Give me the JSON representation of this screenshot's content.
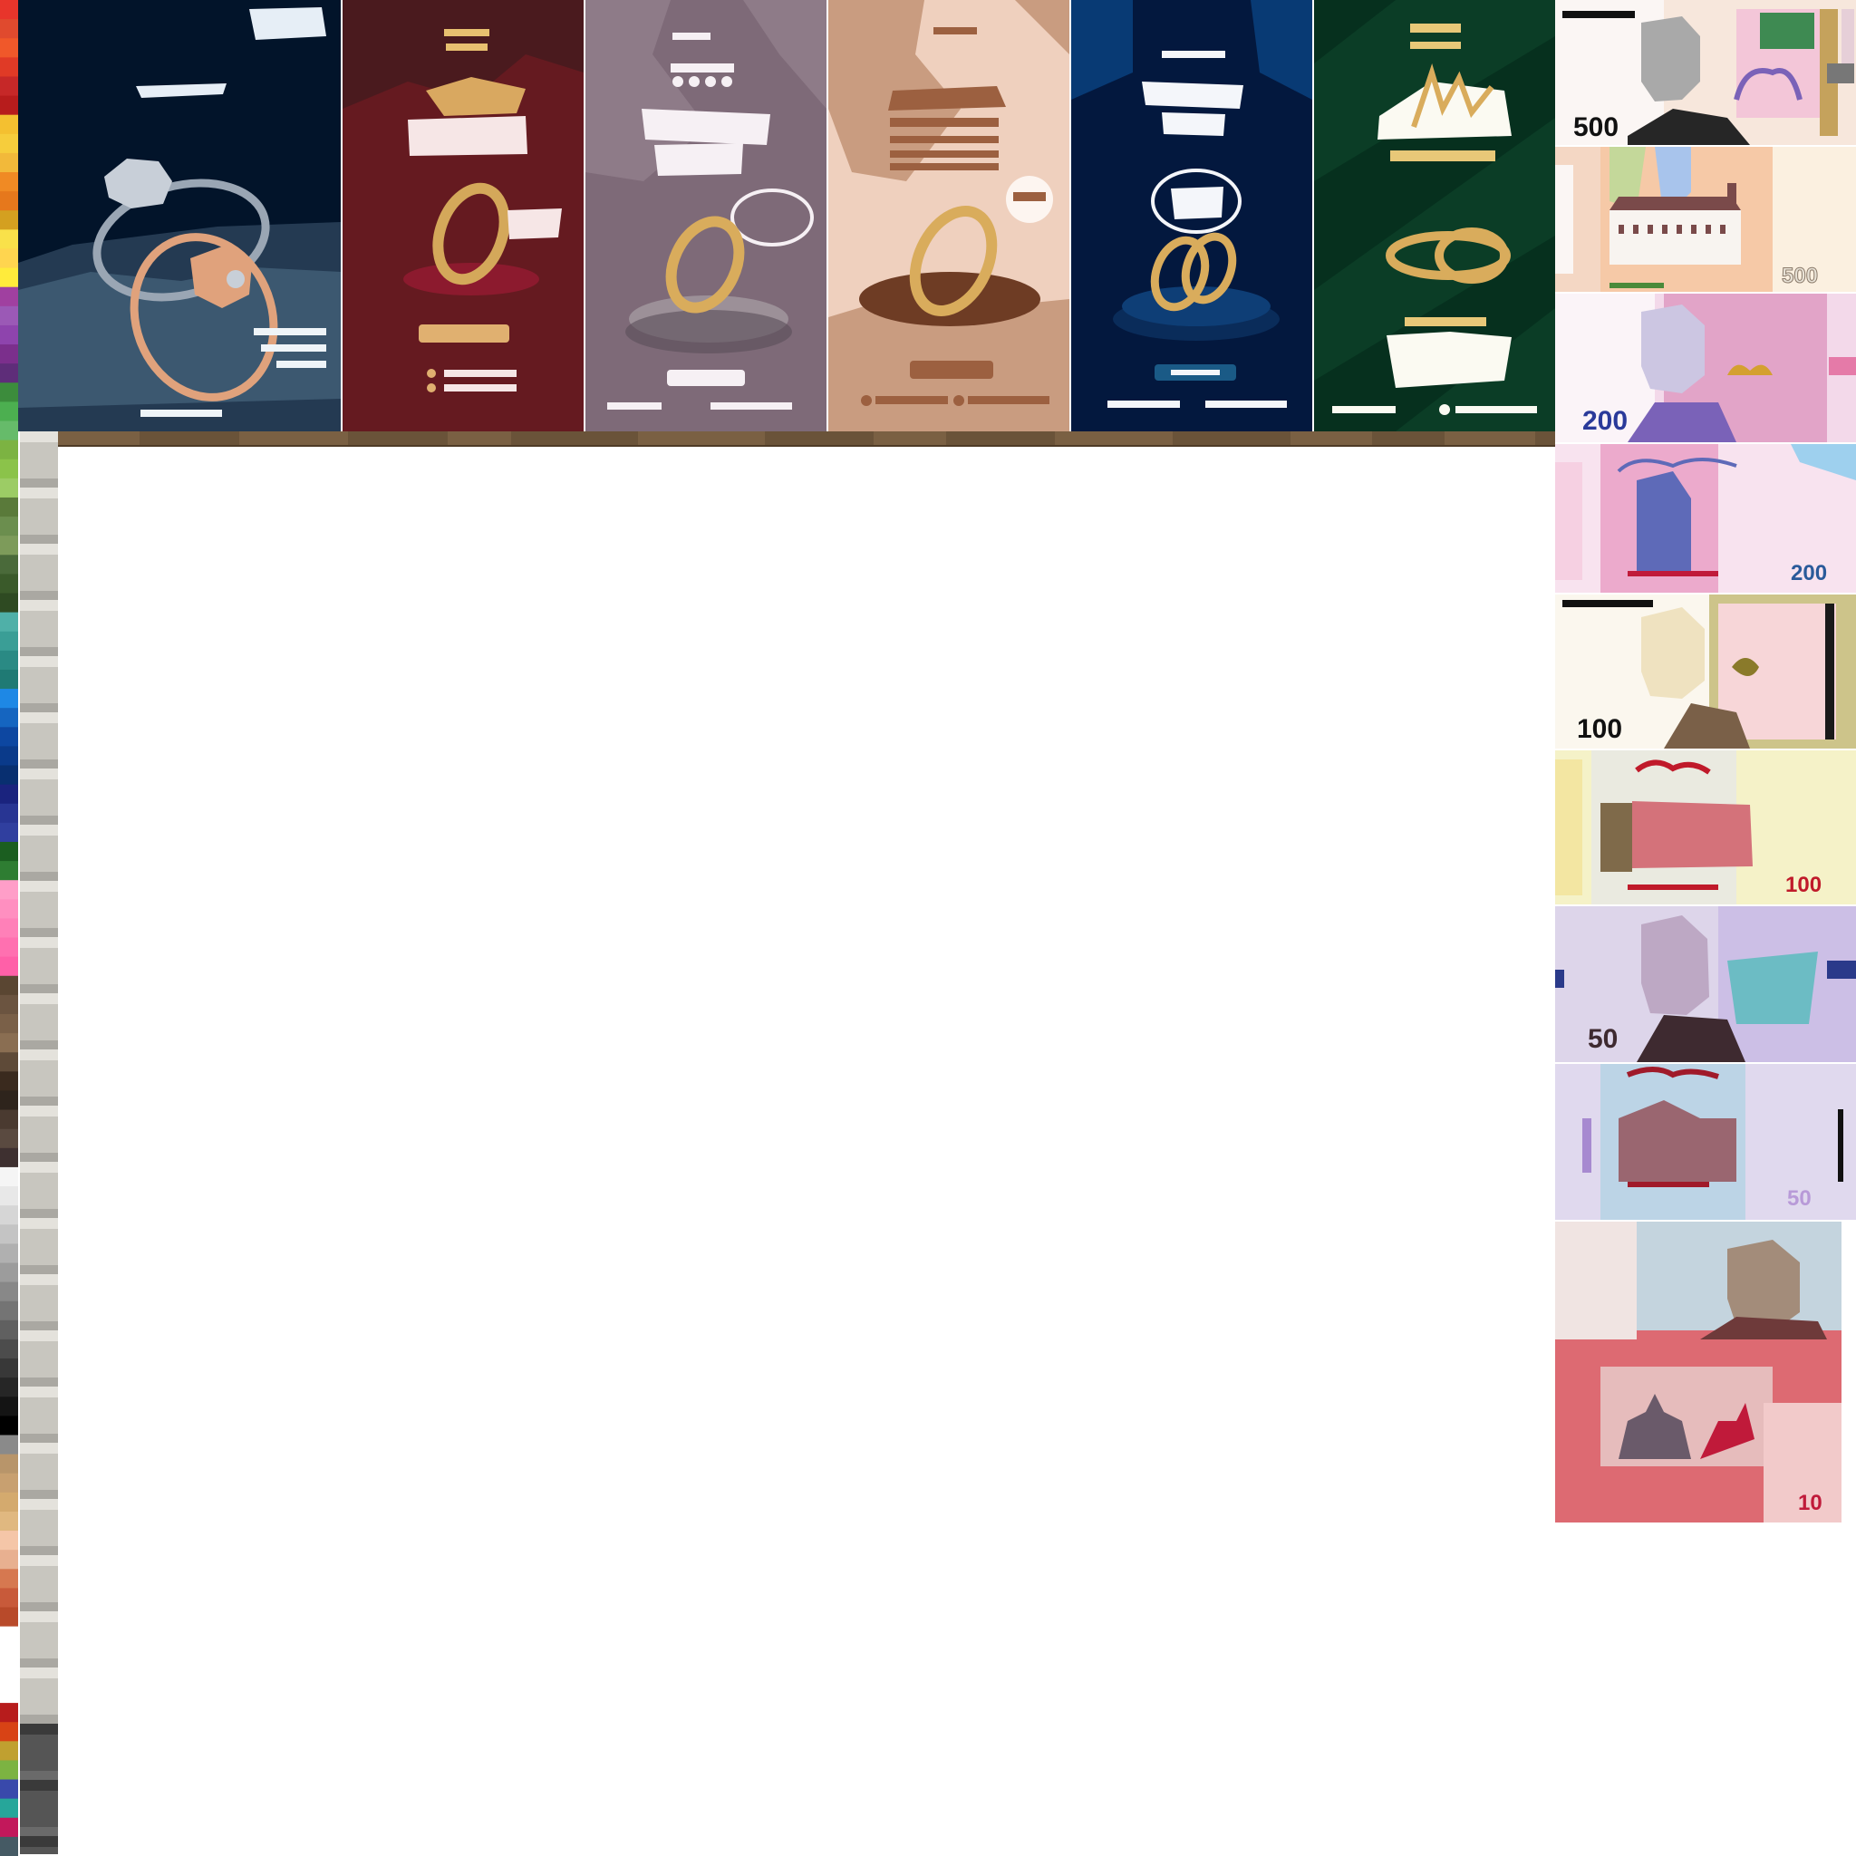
{
  "palette": {
    "colors": [
      "#e8352b",
      "#e04a2e",
      "#f0582a",
      "#e03a26",
      "#c62828",
      "#b71c1c",
      "#f4c030",
      "#f6cd3c",
      "#f2b93a",
      "#f08a24",
      "#e6781c",
      "#d4a020",
      "#f9e14a",
      "#ffd54f",
      "#ffeb3b",
      "#a040a0",
      "#9b59b6",
      "#8e44ad",
      "#7b2f8c",
      "#5e2d79",
      "#3c8c3c",
      "#4caf50",
      "#66bb6a",
      "#7cb342",
      "#8bc34a",
      "#9ccc65",
      "#5a7a3a",
      "#6b8e4e",
      "#7d9b5a",
      "#4a6a3a",
      "#3a5a2a",
      "#2e4a22",
      "#4fb0a8",
      "#3a9e96",
      "#2a8a84",
      "#1f7a74",
      "#1e88e5",
      "#1565c0",
      "#0d47a1",
      "#0a3a8a",
      "#082f70",
      "#1a237e",
      "#283593",
      "#303f9f",
      "#1b5e20",
      "#2e7d32",
      "#ff9ec8",
      "#ff8fc0",
      "#ff80b8",
      "#ff70b0",
      "#ff60a8",
      "#5a4632",
      "#6b5440",
      "#7a6048",
      "#8a6e52",
      "#5e4a38",
      "#3a2a1e",
      "#2e241c",
      "#4a3a30",
      "#5a4a40",
      "#3e3030",
      "#f5f5f5",
      "#e8e8e8",
      "#d6d6d6",
      "#c4c4c4",
      "#b0b0b0",
      "#9c9c9c",
      "#888888",
      "#747474",
      "#606060",
      "#4c4c4c",
      "#383838",
      "#262626",
      "#141414",
      "#000000",
      "#8a8a8a",
      "#b8956a",
      "#c8a070",
      "#d4aa6e",
      "#e0b880",
      "#f5c6a8",
      "#e8b090",
      "#d67850",
      "#c85a3a",
      "#b84a2a",
      "#ffffff",
      "#ffffff",
      "#ffffff",
      "#ffffff",
      "#b71c1c",
      "#d84315",
      "#c0a030",
      "#7cb342",
      "#3949ab",
      "#26a69a",
      "#c2185b",
      "#455a64"
    ]
  },
  "panels": [
    {
      "name": "panel-midnight-rings",
      "bg": "#02142a"
    },
    {
      "name": "panel-crimson-ring",
      "bg": "#4a1a1e"
    },
    {
      "name": "panel-mauve-ring",
      "bg": "#7e6a78"
    },
    {
      "name": "panel-peach-ring",
      "bg": "#efd0be"
    },
    {
      "name": "panel-navy-rings",
      "bg": "#03183e"
    },
    {
      "name": "panel-green-rings",
      "bg": "#0b3d26"
    }
  ],
  "notes": [
    {
      "name": "banknote-500-front",
      "denomination": "500",
      "bg": "#f7e7dc"
    },
    {
      "name": "banknote-500-back",
      "denomination": "500",
      "bg": "#f4d7c4"
    },
    {
      "name": "banknote-200-front",
      "denomination": "200",
      "bg": "#f3d9ea"
    },
    {
      "name": "banknote-200-back",
      "denomination": "200",
      "bg": "#f8e3ef"
    },
    {
      "name": "banknote-100-front",
      "denomination": "100",
      "bg": "#fbf7ee"
    },
    {
      "name": "banknote-100-back",
      "denomination": "100",
      "bg": "#f5f2c8"
    },
    {
      "name": "banknote-50-front",
      "denomination": "50",
      "bg": "#ddd5ea"
    },
    {
      "name": "banknote-50-back",
      "denomination": "50",
      "bg": "#e0d9ee"
    },
    {
      "name": "banknote-10",
      "denomination": "10",
      "bg": "#ecbcbc"
    }
  ]
}
